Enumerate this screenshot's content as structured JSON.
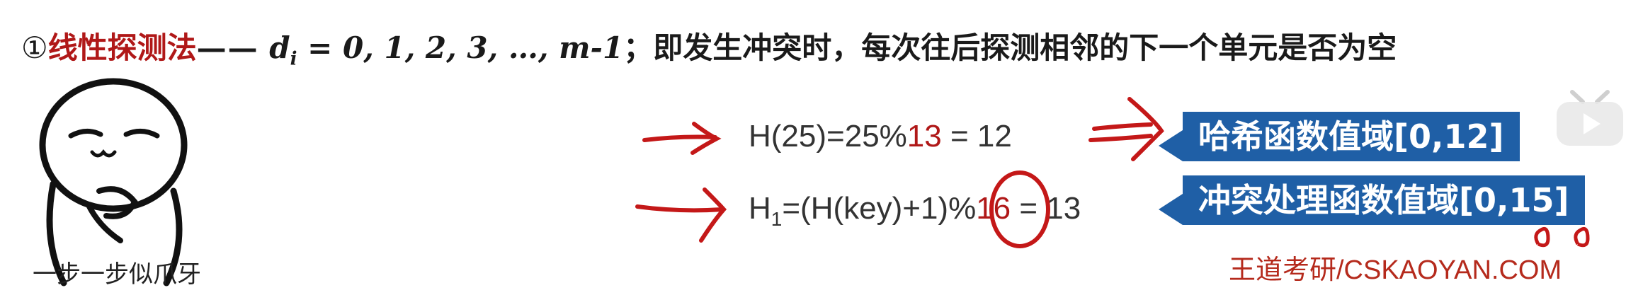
{
  "heading": {
    "number": "①",
    "method": "线性探测法",
    "dash": "——",
    "formula_d": "d",
    "formula_sub": "i",
    "formula_rest": " = 0, 1, 2, 3, …, m-1",
    "semicolon": "；",
    "description": "即发生冲突时，每次往后探测相邻的下一个单元是否为空"
  },
  "meme": {
    "caption": "一步一步似爪牙"
  },
  "equation1": {
    "left": "H(25)=25%",
    "mod": "13",
    "right": " = 12"
  },
  "equation2": {
    "h": "H",
    "sub": "1",
    "left": "=(H(key)+1)%",
    "mod": "16",
    "right": " = 13"
  },
  "badge1": {
    "label": "哈希函数值域[0,12]"
  },
  "badge2": {
    "label": "冲突处理函数值域[0,15]"
  },
  "watermark": {
    "text": "王道考研/CSKAOYAN.COM"
  },
  "colors": {
    "accent_red": "#b01818",
    "badge_blue": "#1f5fa6",
    "watermark": "#b52a1c"
  },
  "icons": {
    "play": "play-icon"
  }
}
